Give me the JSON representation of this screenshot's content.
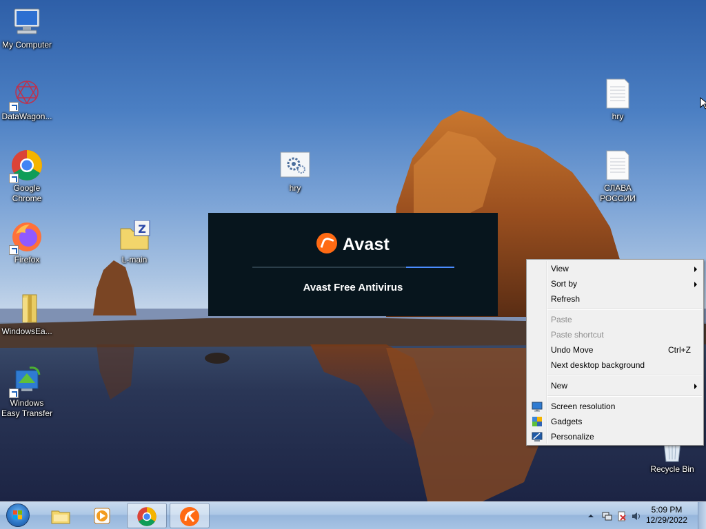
{
  "desktop_icons": {
    "my_computer": "My Computer",
    "datawagon": "DataWagon...",
    "chrome": "Google Chrome",
    "firefox": "Firefox",
    "windowsea": "WindowsEa...",
    "easy_transfer": "Windows Easy Transfer",
    "lmain": "L-main",
    "hry_center": "hry",
    "hry_right": "hry",
    "slava": "СЛАВА РОССИИ",
    "recycle_bin": "Recycle Bin"
  },
  "splash": {
    "brand": "Avast",
    "product": "Avast Free Antivirus",
    "progress": 0.24,
    "brand_color": "#ff6a13",
    "progress_color": "#4b8cff"
  },
  "context_menu": {
    "view": "View",
    "sort_by": "Sort by",
    "refresh": "Refresh",
    "paste": "Paste",
    "paste_shortcut": "Paste shortcut",
    "undo_move": "Undo Move",
    "undo_shortcut": "Ctrl+Z",
    "next_background": "Next desktop background",
    "new": "New",
    "screen_resolution": "Screen resolution",
    "gadgets": "Gadgets",
    "personalize": "Personalize"
  },
  "taskbar": {
    "time": "5:09 PM",
    "date": "12/29/2022"
  }
}
